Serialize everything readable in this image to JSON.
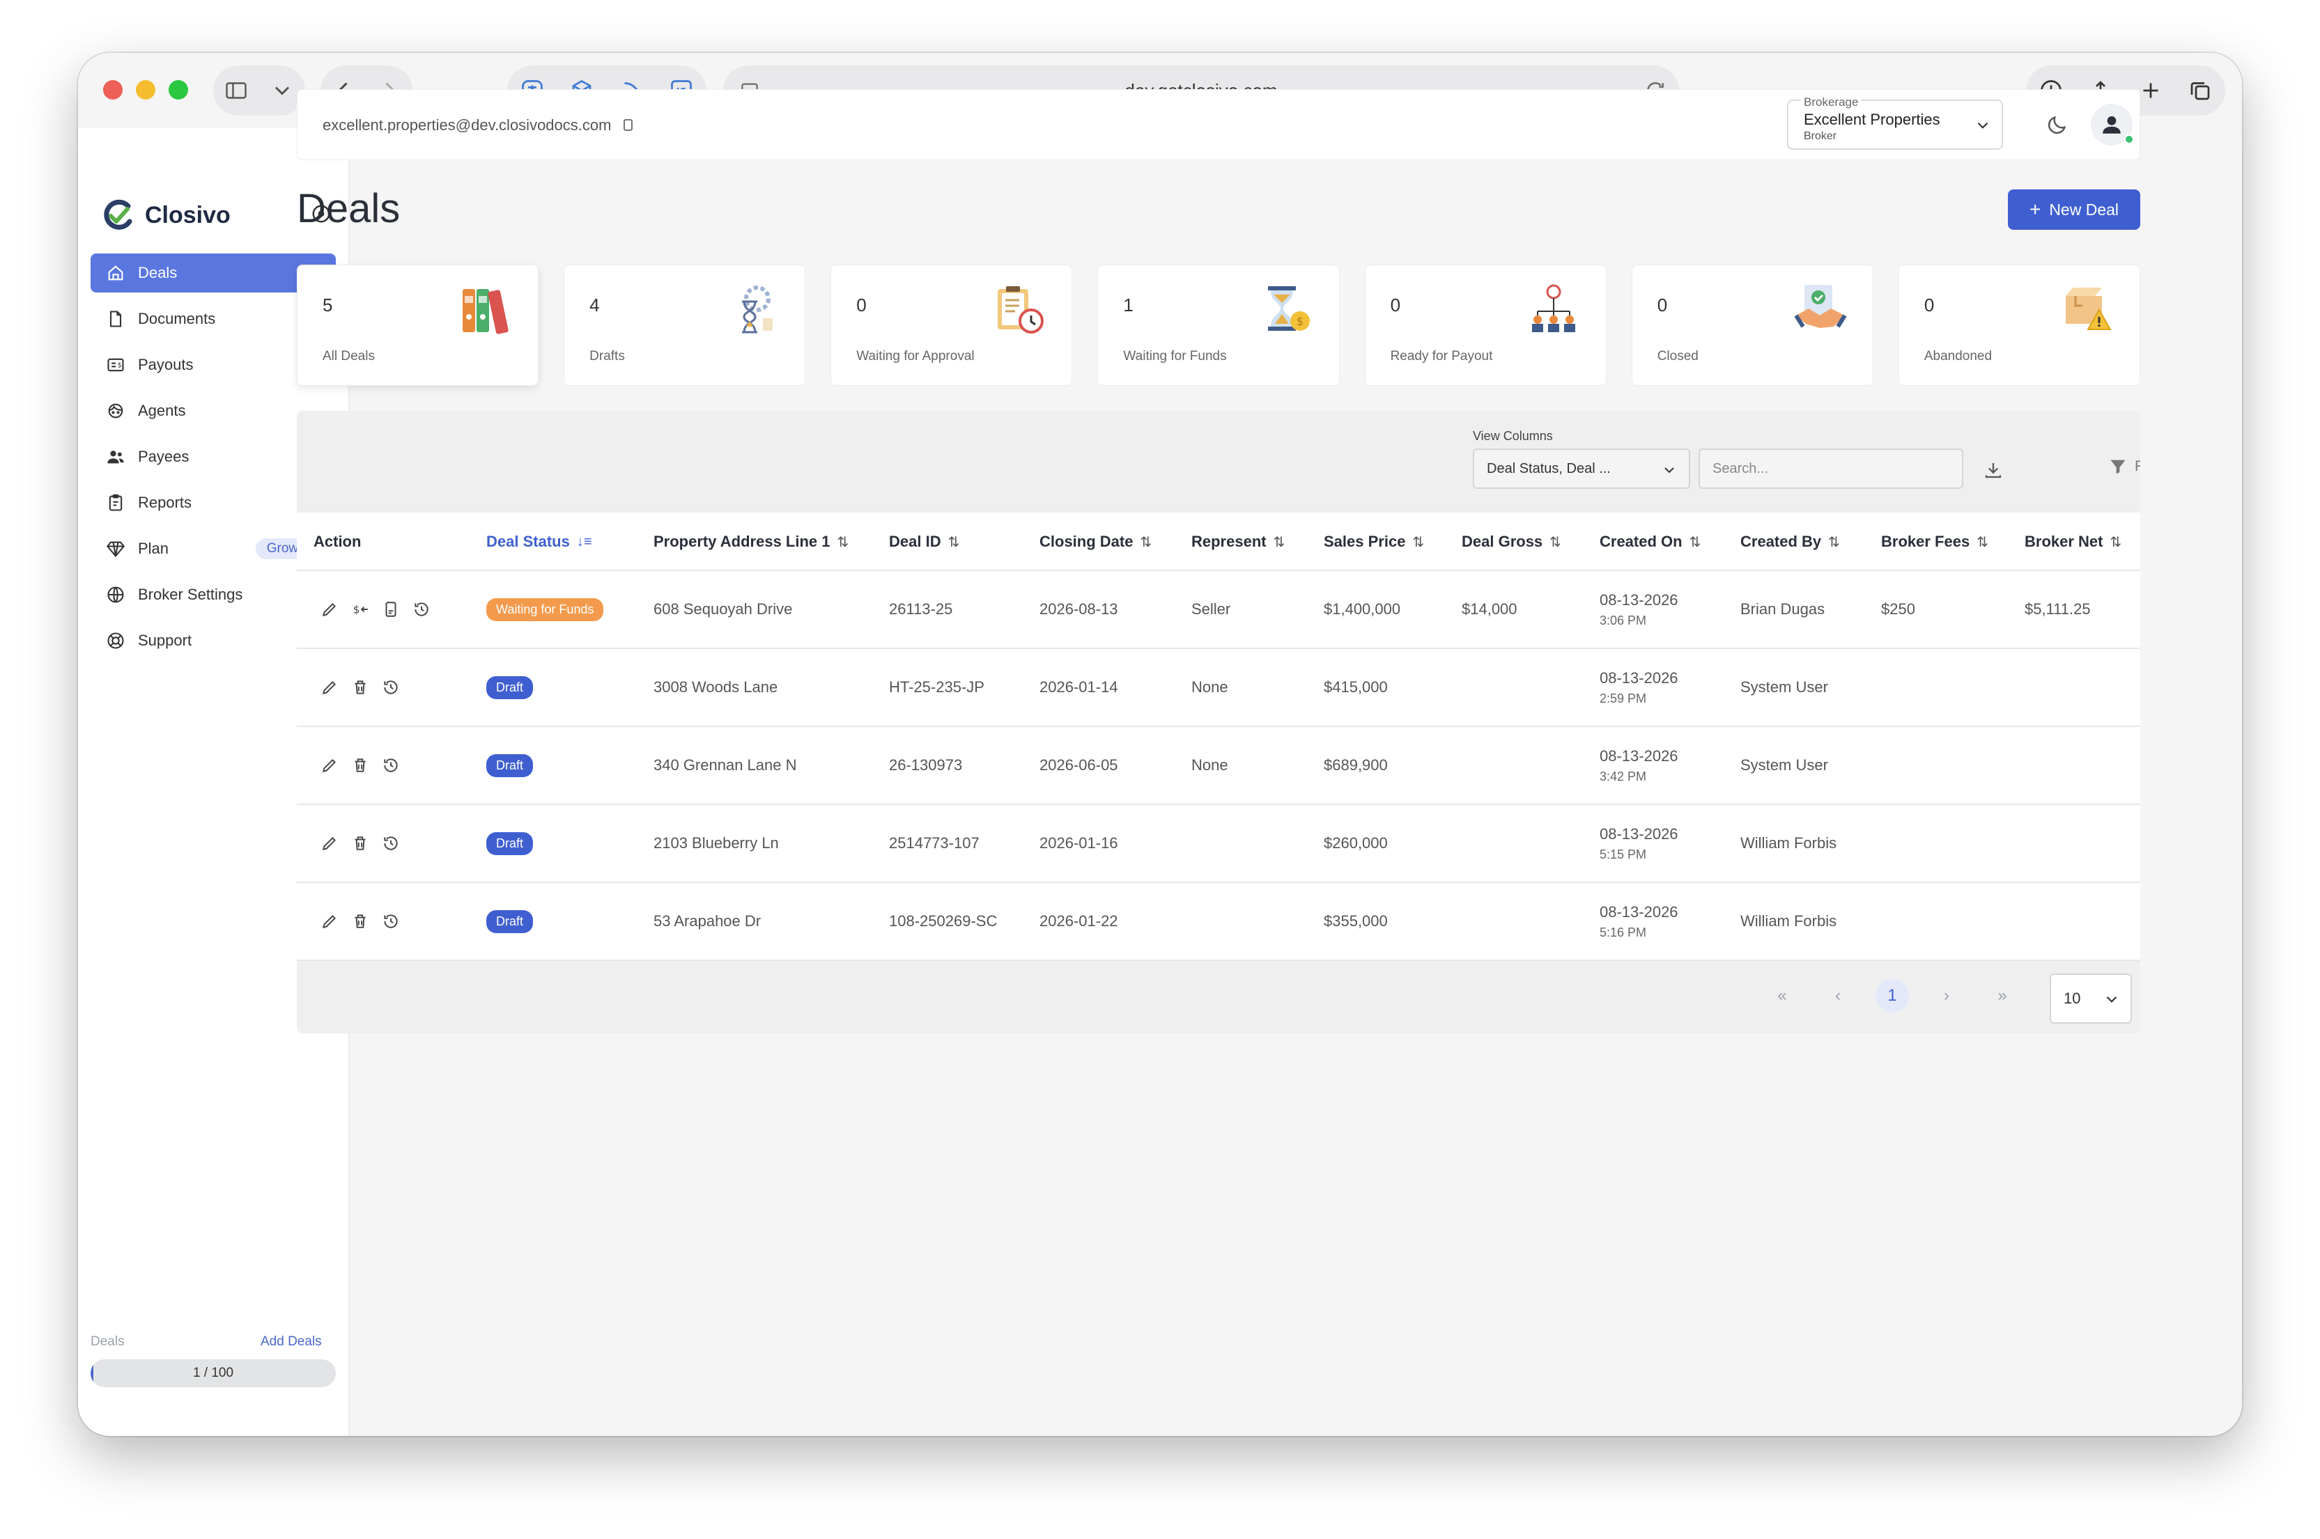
{
  "browser": {
    "url": "dev.getclosivo.com"
  },
  "app": {
    "name": "Closivo",
    "brand_color": "#3f5fd1"
  },
  "sidebar": {
    "items": [
      {
        "label": "Deals",
        "icon": "home-icon",
        "active": true
      },
      {
        "label": "Documents",
        "icon": "document-icon"
      },
      {
        "label": "Payouts",
        "icon": "payouts-icon"
      },
      {
        "label": "Agents",
        "icon": "agents-icon"
      },
      {
        "label": "Payees",
        "icon": "payees-icon"
      },
      {
        "label": "Reports",
        "icon": "reports-icon"
      },
      {
        "label": "Plan",
        "icon": "diamond-icon",
        "badge": "Growth"
      },
      {
        "label": "Broker Settings",
        "icon": "globe-icon"
      },
      {
        "label": "Support",
        "icon": "support-icon"
      }
    ],
    "quota": {
      "label": "Deals",
      "add_label": "Add Deals",
      "text": "1 / 100",
      "fraction": 0.01
    }
  },
  "topbar": {
    "email": "excellent.properties@dev.closivodocs.com",
    "brokerage": {
      "label": "Brokerage",
      "value": "Excellent Properties",
      "role": "Broker"
    }
  },
  "page": {
    "title": "Deals",
    "new_deal_label": "New Deal"
  },
  "stats": [
    {
      "count": "5",
      "label": "All Deals",
      "icon": "binders-icon"
    },
    {
      "count": "4",
      "label": "Drafts",
      "icon": "hourglass-gear-icon"
    },
    {
      "count": "0",
      "label": "Waiting for Approval",
      "icon": "clipboard-clock-icon"
    },
    {
      "count": "1",
      "label": "Waiting for Funds",
      "icon": "hourglass-coin-icon"
    },
    {
      "count": "0",
      "label": "Ready for Payout",
      "icon": "payout-network-icon"
    },
    {
      "count": "0",
      "label": "Closed",
      "icon": "handshake-icon"
    },
    {
      "count": "0",
      "label": "Abandoned",
      "icon": "abandoned-box-icon"
    }
  ],
  "table": {
    "view_columns_label": "View Columns",
    "view_columns_value": "Deal Status, Deal ...",
    "search_placeholder": "Search...",
    "filters_label": "Filters",
    "columns": [
      "Action",
      "Deal Status",
      "Property Address Line 1",
      "Deal ID",
      "Closing Date",
      "Represent",
      "Sales Price",
      "Deal Gross",
      "Created On",
      "Created By",
      "Broker Fees",
      "Broker Net"
    ],
    "rows": [
      {
        "status": "Waiting for Funds",
        "status_color": "#f39a4c",
        "address": "608 Sequoyah Drive",
        "deal_id": "26113-25",
        "closing": "2026-08-13",
        "represent": "Seller",
        "price": "$1,400,000",
        "gross": "$14,000",
        "created_date": "08-13-2026",
        "created_time": "3:06 PM",
        "created_by": "Brian Dugas",
        "fees": "$250",
        "net": "$5,111.25"
      },
      {
        "status": "Draft",
        "status_color": "#3f5fd1",
        "address": "3008 Woods Lane",
        "deal_id": "HT-25-235-JP",
        "closing": "2026-01-14",
        "represent": "None",
        "price": "$415,000",
        "gross": "",
        "created_date": "08-13-2026",
        "created_time": "2:59 PM",
        "created_by": "System User",
        "fees": "",
        "net": ""
      },
      {
        "status": "Draft",
        "status_color": "#3f5fd1",
        "address": "340 Grennan Lane N",
        "deal_id": "26-130973",
        "closing": "2026-06-05",
        "represent": "None",
        "price": "$689,900",
        "gross": "",
        "created_date": "08-13-2026",
        "created_time": "3:42 PM",
        "created_by": "System User",
        "fees": "",
        "net": ""
      },
      {
        "status": "Draft",
        "status_color": "#3f5fd1",
        "address": "2103 Blueberry Ln",
        "deal_id": "2514773-107",
        "closing": "2026-01-16",
        "represent": "",
        "price": "$260,000",
        "gross": "",
        "created_date": "08-13-2026",
        "created_time": "5:15 PM",
        "created_by": "William Forbis",
        "fees": "",
        "net": ""
      },
      {
        "status": "Draft",
        "status_color": "#3f5fd1",
        "address": "53 Arapahoe Dr",
        "deal_id": "108-250269-SC",
        "closing": "2026-01-22",
        "represent": "",
        "price": "$355,000",
        "gross": "",
        "created_date": "08-13-2026",
        "created_time": "5:16 PM",
        "created_by": "William Forbis",
        "fees": "",
        "net": ""
      }
    ]
  },
  "pagination": {
    "first": "«",
    "prev": "‹",
    "current": "1",
    "next": "›",
    "last": "»",
    "per_page": "10"
  }
}
